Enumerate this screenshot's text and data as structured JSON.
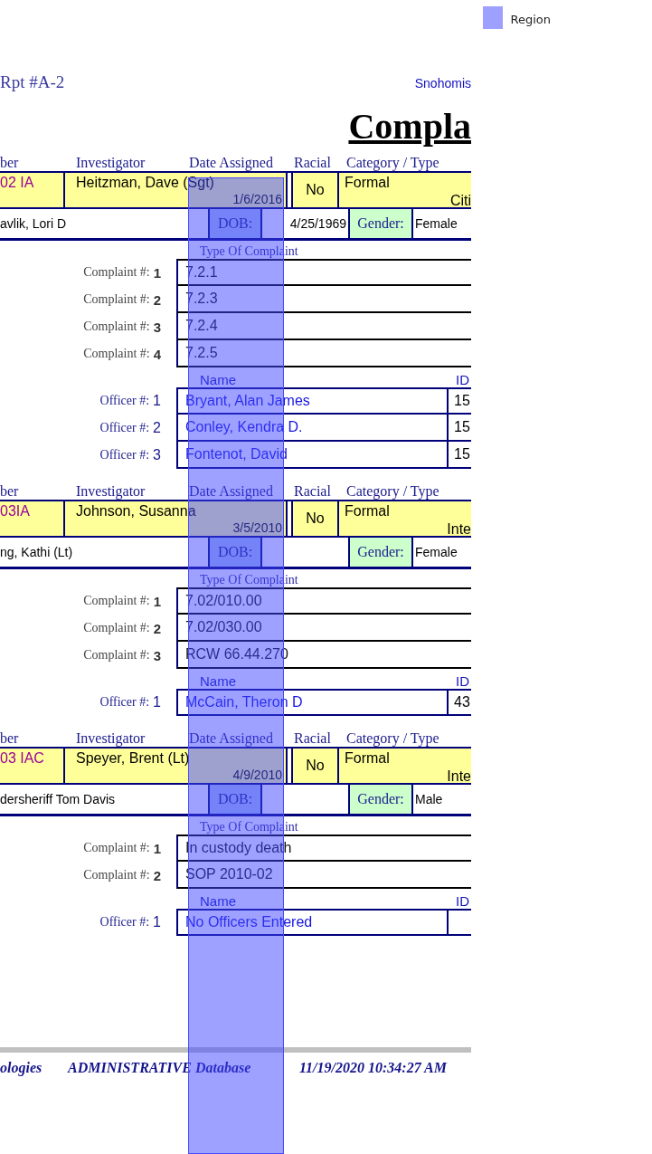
{
  "legend": {
    "label": "Region"
  },
  "header": {
    "report_id": "Rpt #A-2",
    "agency": "Snohomis",
    "title": "Compla"
  },
  "cases": [
    {
      "headers": {
        "number": "ber",
        "investigator": "Investigator",
        "date_assigned": "Date Assigned",
        "racial": "Racial",
        "category": "Category / Type"
      },
      "number": "02 IA",
      "investigator": "Heitzman, Dave (Sgt)",
      "date_assigned": "1/6/2016",
      "racial": "No",
      "category": "Formal",
      "type": "Citi",
      "complainant": "avlik, Lori D",
      "dob_label": "DOB:",
      "dob": "4/25/1969",
      "gender_label": "Gender:",
      "gender": "Female",
      "complaint_header": "Type Of Complaint",
      "complaints": [
        {
          "label": "Complaint #:",
          "num": "1",
          "text": "7.2.1"
        },
        {
          "label": "Complaint #:",
          "num": "2",
          "text": "7.2.3"
        },
        {
          "label": "Complaint #:",
          "num": "3",
          "text": "7.2.4"
        },
        {
          "label": "Complaint #:",
          "num": "4",
          "text": "7.2.5"
        }
      ],
      "officer_headers": {
        "name": "Name",
        "id": "ID"
      },
      "officers": [
        {
          "label": "Officer #:",
          "num": "1",
          "name": "Bryant, Alan James",
          "id": "15"
        },
        {
          "label": "Officer #:",
          "num": "2",
          "name": "Conley, Kendra D.",
          "id": "15"
        },
        {
          "label": "Officer #:",
          "num": "3",
          "name": "Fontenot, David",
          "id": "15"
        }
      ]
    },
    {
      "headers": {
        "number": "ber",
        "investigator": "Investigator",
        "date_assigned": "Date Assigned",
        "racial": "Racial",
        "category": "Category / Type"
      },
      "number": "03IA",
      "investigator": "Johnson, Susanna",
      "date_assigned": "3/5/2010",
      "racial": "No",
      "category": "Formal",
      "type": "Inte",
      "complainant": "ng, Kathi (Lt)",
      "dob_label": "DOB:",
      "gender_label": "Gender:",
      "gender": "Female",
      "complaint_header": "Type Of Complaint",
      "complaints": [
        {
          "label": "Complaint #:",
          "num": "1",
          "text": "7.02/010.00"
        },
        {
          "label": "Complaint #:",
          "num": "2",
          "text": "7.02/030.00"
        },
        {
          "label": "Complaint #:",
          "num": "3",
          "text": "RCW 66.44.270"
        }
      ],
      "officer_headers": {
        "name": "Name",
        "id": "ID"
      },
      "officers": [
        {
          "label": "Officer #:",
          "num": "1",
          "name": "McCain, Theron D",
          "id": "43"
        }
      ]
    },
    {
      "headers": {
        "number": "ber",
        "investigator": "Investigator",
        "date_assigned": "Date Assigned",
        "racial": "Racial",
        "category": "Category / Type"
      },
      "number": "03 IAC",
      "investigator": "Speyer, Brent (Lt)",
      "date_assigned": "4/9/2010",
      "racial": "No",
      "category": "Formal",
      "type": "Inte",
      "complainant": "dersheriff Tom Davis",
      "dob_label": "DOB:",
      "gender_label": "Gender:",
      "gender": "Male",
      "complaint_header": "Type Of Complaint",
      "complaints": [
        {
          "label": "Complaint #:",
          "num": "1",
          "text": "In custody death"
        },
        {
          "label": "Complaint #:",
          "num": "2",
          "text": "SOP 2010-02"
        }
      ],
      "officer_headers": {
        "name": "Name",
        "id": "ID"
      },
      "officers": [
        {
          "label": "Officer #:",
          "num": "1",
          "name": "No Officers Entered"
        }
      ]
    }
  ],
  "footer": {
    "company": "ologies",
    "database": "ADMINISTRATIVE Database",
    "timestamp": "11/19/2020 10:34:27 AM"
  }
}
